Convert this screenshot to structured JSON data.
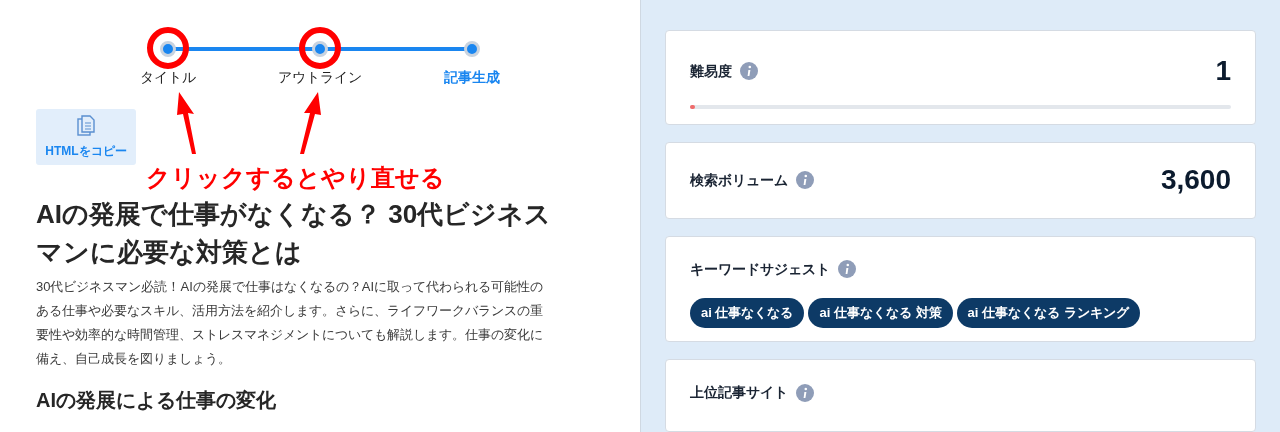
{
  "steps": [
    {
      "label": "タイトル",
      "selected": false
    },
    {
      "label": "アウトライン",
      "selected": false
    },
    {
      "label": "記事生成",
      "selected": true
    }
  ],
  "copy_button": {
    "label": "HTMLをコピー"
  },
  "annotation": {
    "text": "クリックするとやり直せる"
  },
  "article": {
    "title": "AIの発展で仕事がなくなる？ 30代ビジネスマンに必要な対策とは",
    "lead": "30代ビジネスマン必読！AIの発展で仕事はなくなるの？AIに取って代わられる可能性のある仕事や必要なスキル、活用方法を紹介します。さらに、ライフワークバランスの重要性や効率的な時間管理、ストレスマネジメントについても解説します。仕事の変化に備え、自己成長を図りましょう。",
    "section_heading": "AIの発展による仕事の変化"
  },
  "metrics": [
    {
      "kind": "level",
      "label": "難易度",
      "value": "1",
      "level": 0.01
    },
    {
      "kind": "number",
      "label": "検索ボリューム",
      "value": "3,600"
    },
    {
      "kind": "tags",
      "label": "キーワードサジェスト",
      "tags": [
        "ai 仕事なくなる",
        "ai 仕事なくなる 対策",
        "ai 仕事なくなる ランキング"
      ]
    },
    {
      "kind": "header",
      "label": "上位記事サイト"
    }
  ]
}
